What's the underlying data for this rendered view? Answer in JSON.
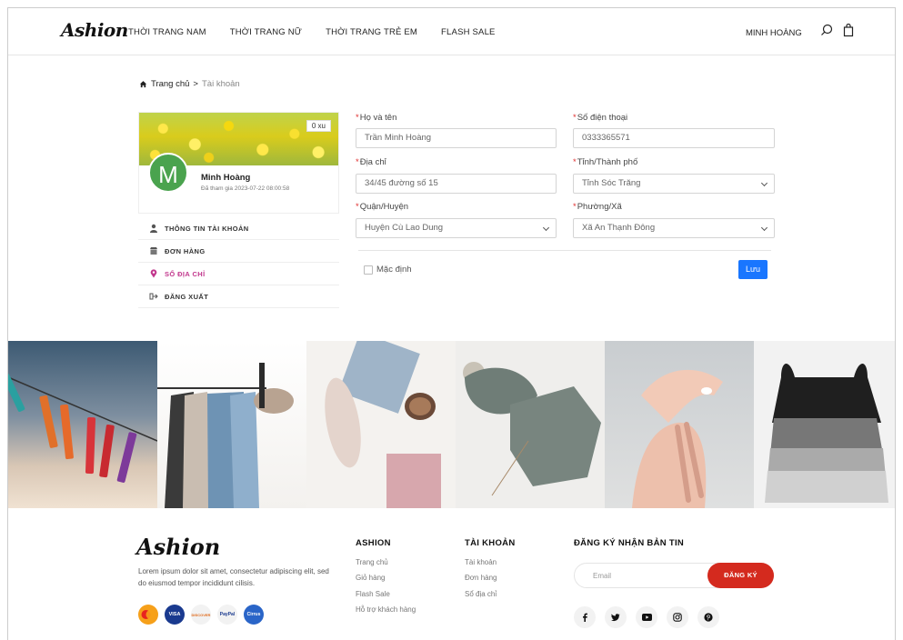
{
  "brand": "Ashion",
  "nav": [
    "THỜI TRANG NAM",
    "THỜI TRANG NỮ",
    "THỜI TRANG TRẺ EM",
    "FLASH SALE"
  ],
  "header": {
    "user_name": "MINH HOÀNG"
  },
  "breadcrumb": {
    "home": "Trang chủ",
    "separator": ">",
    "current": "Tài khoản"
  },
  "profile": {
    "coins": "0 xu",
    "avatar_letter": "M",
    "name": "Minh Hoàng",
    "joined": "Đã tham gia 2023-07-22 08:00:58"
  },
  "sidebar": {
    "items": [
      {
        "label": "THÔNG TIN TÀI KHOẢN",
        "icon": "user-icon"
      },
      {
        "label": "ĐƠN HÀNG",
        "icon": "store-icon"
      },
      {
        "label": "SỔ ĐỊA CHỈ",
        "icon": "map-pin-icon"
      },
      {
        "label": "ĐĂNG XUẤT",
        "icon": "sign-out-icon"
      }
    ]
  },
  "form": {
    "fullname": {
      "label": "Họ và tên",
      "value": "Trần Minh Hoàng"
    },
    "phone": {
      "label": "Số điện thoại",
      "value": "0333365571"
    },
    "address": {
      "label": "Địa chỉ",
      "value": "34/45 đường số 15"
    },
    "province": {
      "label": "Tỉnh/Thành phố",
      "value": "Tỉnh Sóc Trăng"
    },
    "district": {
      "label": "Quận/Huyện",
      "value": "Huyện Cù Lao Dung"
    },
    "ward": {
      "label": "Phường/Xã",
      "value": "Xã An Thạnh Đông"
    },
    "default_label": "Mặc định",
    "save_label": "Lưu"
  },
  "footer": {
    "description": "Lorem ipsum dolor sit amet, consectetur adipiscing elit, sed do eiusmod tempor incididunt cilisis.",
    "payment_cards": [
      "mastercard",
      "VISA",
      "DISCOVER",
      "PayPal",
      "Cirrus"
    ],
    "col1": {
      "title": "ASHION",
      "links": [
        "Trang chủ",
        "Giỏ hàng",
        "Flash Sale",
        "Hỗ trợ khách hàng"
      ]
    },
    "col2": {
      "title": "TÀI KHOẢN",
      "links": [
        "Tài khoản",
        "Đơn hàng",
        "Sổ địa chỉ"
      ]
    },
    "newsletter": {
      "title": "ĐĂNG KÝ NHẬN BẢN TIN",
      "placeholder": "Email",
      "button": "ĐĂNG KÝ"
    },
    "socials": [
      "facebook-icon",
      "twitter-icon",
      "youtube-icon",
      "instagram-icon",
      "pinterest-icon"
    ]
  },
  "colors": {
    "accent": "#1976ff",
    "subscribe": "#d42a1e",
    "active_menu": "#c2388d",
    "avatar": "#4aa34e"
  }
}
